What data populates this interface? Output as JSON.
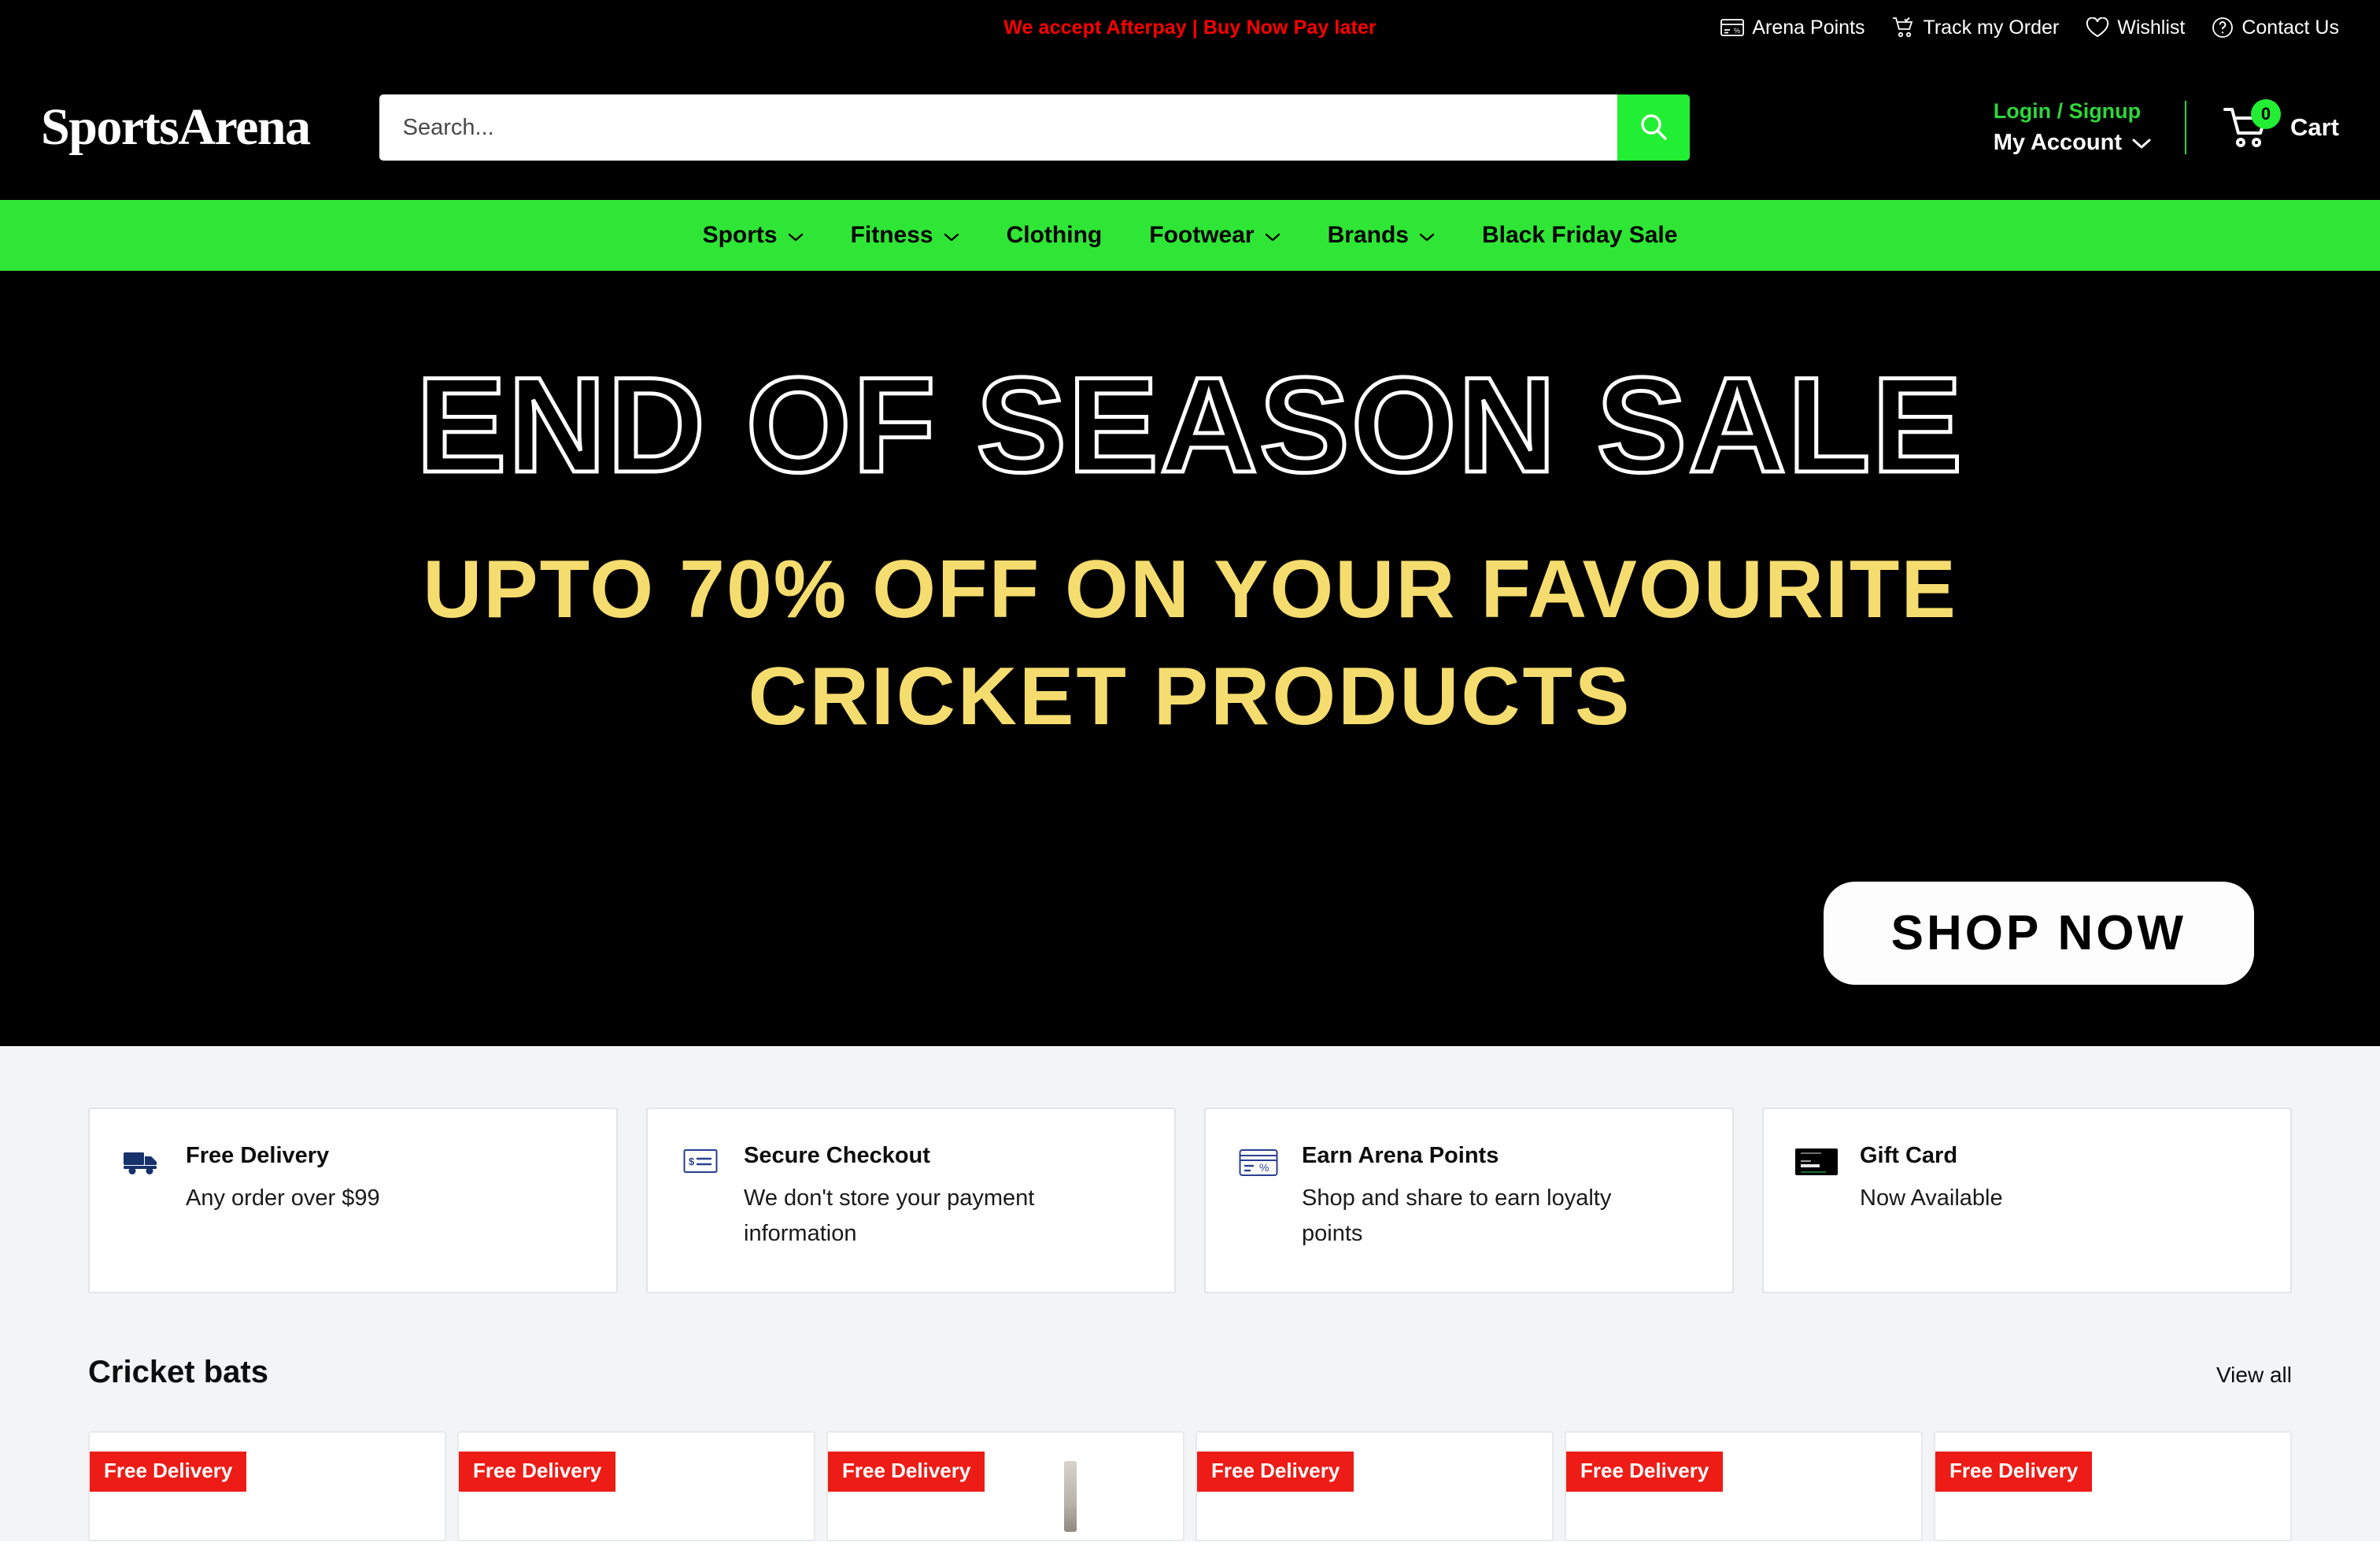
{
  "announcement": {
    "text": "We accept Afterpay | Buy Now Pay later",
    "color": "#ff0000",
    "links": [
      {
        "label": "Arena Points",
        "icon": "card-percent-icon"
      },
      {
        "label": "Track my Order",
        "icon": "cart-check-icon"
      },
      {
        "label": "Wishlist",
        "icon": "heart-icon"
      },
      {
        "label": "Contact Us",
        "icon": "question-circle-icon"
      }
    ]
  },
  "header": {
    "logo": "SportsArena",
    "search": {
      "value": "",
      "placeholder": "Search...",
      "button_icon": "search-icon"
    },
    "account": {
      "login_label": "Login / Signup",
      "my_account_label": "My Account",
      "chevron": "chevron-down-icon"
    },
    "cart": {
      "count": "0",
      "label": "Cart",
      "icon": "shopping-cart-icon"
    }
  },
  "nav": {
    "items": [
      {
        "label": "Sports",
        "has_dropdown": true
      },
      {
        "label": "Fitness",
        "has_dropdown": true
      },
      {
        "label": "Clothing",
        "has_dropdown": false
      },
      {
        "label": "Footwear",
        "has_dropdown": true
      },
      {
        "label": "Brands",
        "has_dropdown": true
      },
      {
        "label": "Black Friday Sale",
        "has_dropdown": false
      }
    ],
    "background": "#2fe636"
  },
  "hero": {
    "title": "END OF SEASON SALE",
    "subtitle_line1": "UPTO 70%  OFF ON YOUR FAVOURITE",
    "subtitle_line2": "CRICKET PRODUCTS",
    "cta_label": "SHOP NOW",
    "accent_color": "#f5dc6e"
  },
  "features": [
    {
      "icon": "delivery-truck-icon",
      "title": "Free Delivery",
      "description": "Any order over $99"
    },
    {
      "icon": "secure-payment-card-icon",
      "title": "Secure Checkout",
      "description": "We don't store your payment information"
    },
    {
      "icon": "loyalty-card-percent-icon",
      "title": "Earn Arena Points",
      "description": "Shop and share to earn loyalty points"
    },
    {
      "icon": "gift-card-thumbnail",
      "title": "Gift Card",
      "description": "Now Available"
    }
  ],
  "product_section": {
    "title": "Cricket bats",
    "view_all_label": "View all",
    "products": [
      {
        "badge": "Free Delivery"
      },
      {
        "badge": "Free Delivery"
      },
      {
        "badge": "Free Delivery"
      },
      {
        "badge": "Free Delivery"
      },
      {
        "badge": "Free Delivery"
      },
      {
        "badge": "Free Delivery"
      }
    ]
  }
}
